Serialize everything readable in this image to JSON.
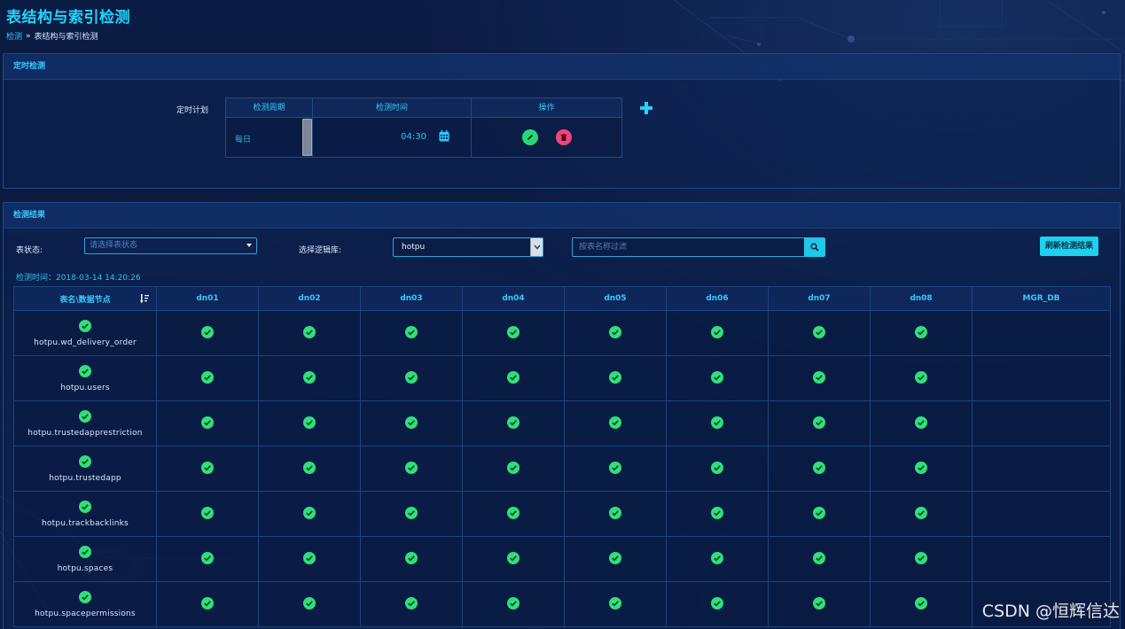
{
  "page_title": "表结构与索引检测",
  "breadcrumb": {
    "root": "检测",
    "separator": "»",
    "current": "表结构与索引检测"
  },
  "schedule": {
    "section_title": "定时检测",
    "label": "定时计划",
    "columns": [
      "检测周期",
      "检测时间",
      "操作"
    ],
    "row": {
      "period": "每日",
      "time": "04:30"
    },
    "icons": {
      "calendar": "calendar-icon",
      "edit": "pencil-icon",
      "delete": "trash-icon",
      "add": "plus-icon"
    },
    "colors": {
      "edit": "#29d67a",
      "delete": "#f0457a",
      "add": "#1fd6ff"
    }
  },
  "results": {
    "section_title": "检测结果",
    "filters": {
      "status_label": "表状态:",
      "status_placeholder": "请选择表状态",
      "db_label": "选择逻辑库:",
      "db_value": "hotpu",
      "search_placeholder": "按表名称过滤",
      "refresh_label": "刷新检测结果"
    },
    "check_time": "检测时间：2018-03-14 14:20:26",
    "table": {
      "first_col": "表名\\数据节点",
      "columns": [
        "dn01",
        "dn02",
        "dn03",
        "dn04",
        "dn05",
        "dn06",
        "dn07",
        "dn08",
        "MGR_DB"
      ],
      "rows": [
        {
          "name": "hotpu.wd_delivery_order",
          "status": [
            1,
            1,
            1,
            1,
            1,
            1,
            1,
            1,
            0
          ]
        },
        {
          "name": "hotpu.users",
          "status": [
            1,
            1,
            1,
            1,
            1,
            1,
            1,
            1,
            0
          ]
        },
        {
          "name": "hotpu.trustedapprestriction",
          "status": [
            1,
            1,
            1,
            1,
            1,
            1,
            1,
            1,
            0
          ]
        },
        {
          "name": "hotpu.trustedapp",
          "status": [
            1,
            1,
            1,
            1,
            1,
            1,
            1,
            1,
            0
          ]
        },
        {
          "name": "hotpu.trackbacklinks",
          "status": [
            1,
            1,
            1,
            1,
            1,
            1,
            1,
            1,
            0
          ]
        },
        {
          "name": "hotpu.spaces",
          "status": [
            1,
            1,
            1,
            1,
            1,
            1,
            1,
            1,
            0
          ]
        },
        {
          "name": "hotpu.spacepermissions",
          "status": [
            1,
            1,
            1,
            1,
            1,
            1,
            1,
            1,
            0
          ]
        }
      ]
    },
    "colors": {
      "ok": "#2fe07a",
      "header": "#38c8ff"
    }
  },
  "watermark": "CSDN @恒辉信达"
}
